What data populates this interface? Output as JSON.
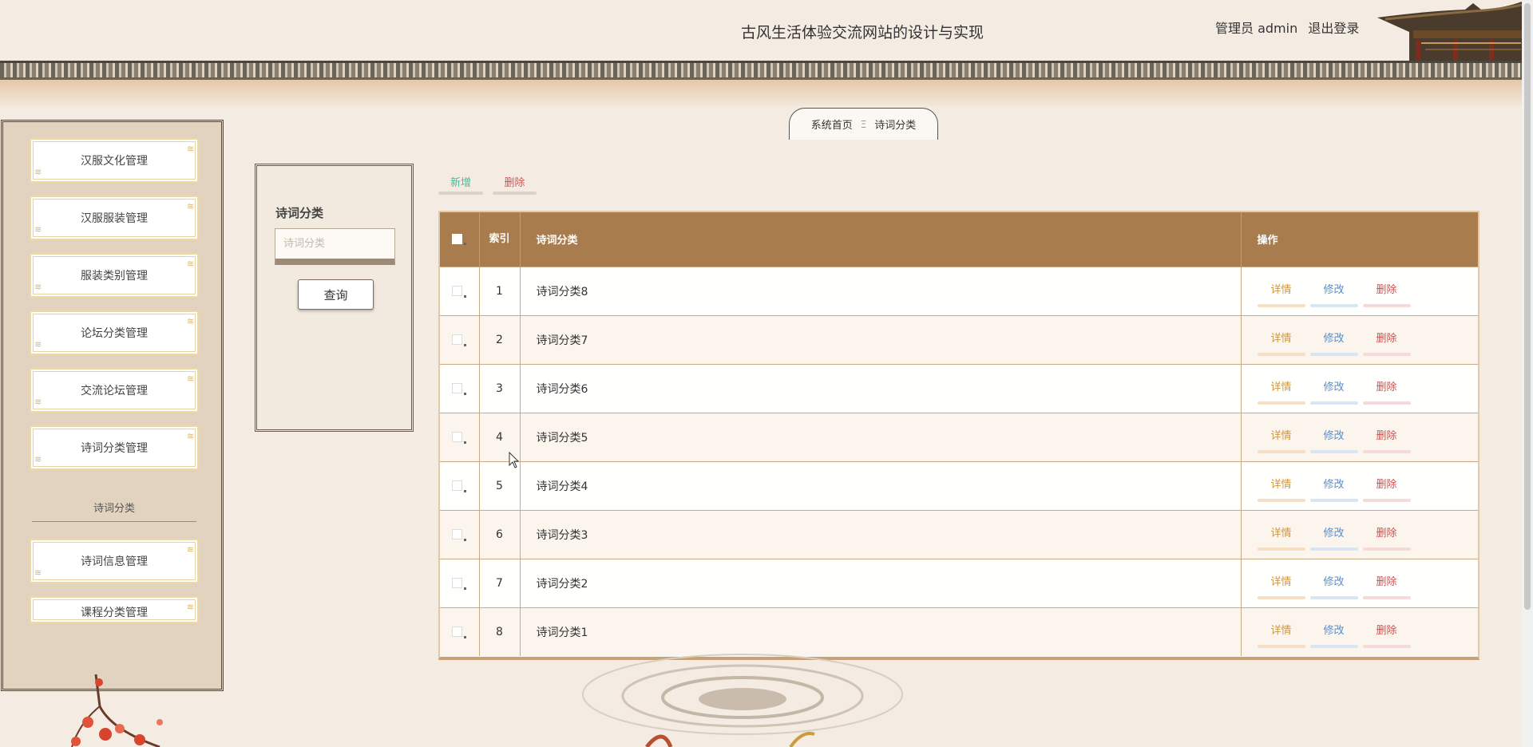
{
  "header": {
    "site_title": "古风生活体验交流网站的设计与实现",
    "user_label": "管理员 admin",
    "logout_label": "退出登录"
  },
  "breadcrumb": {
    "home": "系统首页",
    "separator": "Ξ",
    "current": "诗词分类"
  },
  "sidebar": {
    "items_top": [
      {
        "label": "汉服文化管理"
      },
      {
        "label": "汉服服装管理"
      },
      {
        "label": "服装类别管理"
      },
      {
        "label": "论坛分类管理"
      },
      {
        "label": "交流论坛管理"
      },
      {
        "label": "诗词分类管理"
      }
    ],
    "group_label": "诗词分类",
    "items_bottom": [
      {
        "label": "诗词信息管理"
      },
      {
        "label": "课程分类管理"
      }
    ]
  },
  "search": {
    "label": "诗词分类",
    "placeholder": "诗词分类",
    "button": "查询"
  },
  "toolbar": {
    "add_label": "新增",
    "delete_label": "删除"
  },
  "table": {
    "headers": {
      "index": "索引",
      "name": "诗词分类",
      "ops": "操作"
    },
    "rows": [
      {
        "index": "1",
        "name": "诗词分类8"
      },
      {
        "index": "2",
        "name": "诗词分类7"
      },
      {
        "index": "3",
        "name": "诗词分类6"
      },
      {
        "index": "4",
        "name": "诗词分类5"
      },
      {
        "index": "5",
        "name": "诗词分类4"
      },
      {
        "index": "6",
        "name": "诗词分类3"
      },
      {
        "index": "7",
        "name": "诗词分类2"
      },
      {
        "index": "8",
        "name": "诗词分类1"
      }
    ],
    "actions": {
      "detail": "详情",
      "edit": "修改",
      "delete": "删除"
    }
  },
  "colors": {
    "table_header_bg": "#a87c4c",
    "add_color": "#3bbfa0",
    "delete_color": "#d25656",
    "detail_color": "#d2953c",
    "edit_color": "#5b8cc8"
  }
}
